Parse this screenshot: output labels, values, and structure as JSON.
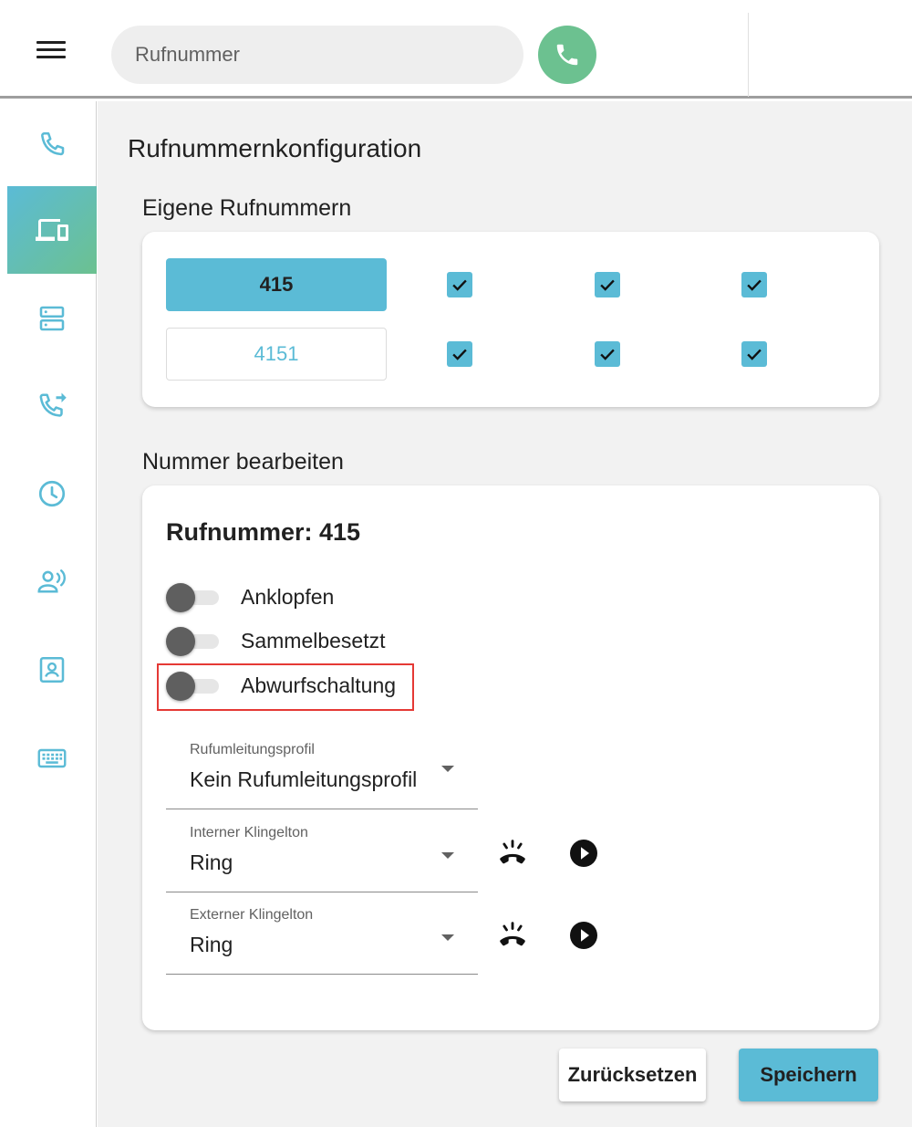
{
  "topbar": {
    "search_placeholder": "Rufnummer"
  },
  "sidebar": {
    "items": [
      {
        "icon": "phone-icon",
        "active": false
      },
      {
        "icon": "devices-icon",
        "active": true
      },
      {
        "icon": "server-icon",
        "active": false
      },
      {
        "icon": "call-forward-icon",
        "active": false
      },
      {
        "icon": "clock-icon",
        "active": false
      },
      {
        "icon": "voice-person-icon",
        "active": false
      },
      {
        "icon": "contact-book-icon",
        "active": false
      },
      {
        "icon": "keyboard-icon",
        "active": false
      }
    ]
  },
  "main": {
    "page_title": "Rufnummernkonfiguration",
    "own_numbers_title": "Eigene Rufnummern",
    "numbers": [
      {
        "number": "415",
        "selected": true,
        "checks": [
          true,
          true,
          true
        ]
      },
      {
        "number": "4151",
        "selected": false,
        "checks": [
          true,
          true,
          true
        ]
      }
    ],
    "edit_title": "Nummer bearbeiten",
    "edit": {
      "heading": "Rufnummer: 415",
      "toggles": [
        {
          "label": "Anklopfen",
          "on": false
        },
        {
          "label": "Sammelbesetzt",
          "on": false
        },
        {
          "label": "Abwurfschaltung",
          "on": false
        }
      ],
      "forward_profile": {
        "label": "Rufumleitungsprofil",
        "value": "Kein Rufumleitungsprofil"
      },
      "internal_ringtone": {
        "label": "Interner Klingelton",
        "value": "Ring"
      },
      "external_ringtone": {
        "label": "Externer Klingelton",
        "value": "Ring"
      }
    },
    "buttons": {
      "reset": "Zurücksetzen",
      "save": "Speichern"
    }
  },
  "colors": {
    "accent": "#5bbbd6",
    "call_green": "#6cc190",
    "highlight": "#e53935"
  }
}
